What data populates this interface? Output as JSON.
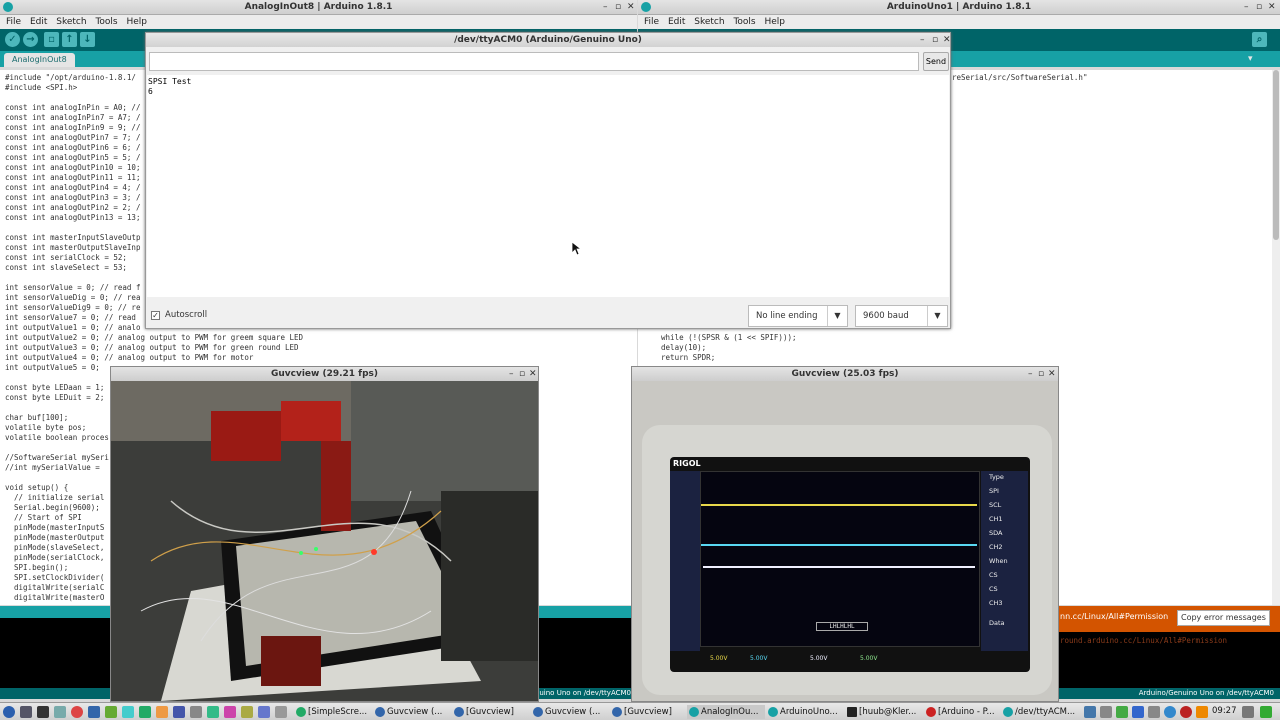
{
  "left_window": {
    "title": "AnalogInOut8 | Arduino 1.8.1",
    "menu": [
      "File",
      "Edit",
      "Sketch",
      "Tools",
      "Help"
    ],
    "tab": "AnalogInOut8",
    "code_lines": [
      "#include \"/opt/arduino-1.8.1/",
      "#include <SPI.h>",
      "",
      "const int analogInPin = A0; //",
      "const int analogInPin7 = A7; /",
      "const int analogInPin9 = 9; //",
      "const int analogOutPin7 = 7; /",
      "const int analogOutPin6 = 6; /",
      "const int analogOutPin5 = 5; /",
      "const int analogOutPin10 = 10;",
      "const int analogOutPin11 = 11;",
      "const int analogOutPin4 = 4; /",
      "const int analogOutPin3 = 3; /",
      "const int analogOutPin2 = 2; /",
      "const int analogOutPin13 = 13;",
      "",
      "const int masterInputSlaveOutp",
      "const int masterOutputSlaveInp",
      "const int serialClock = 52;",
      "const int slaveSelect = 53;",
      "",
      "int sensorValue = 0; // read f",
      "int sensorValueDig = 0; // rea",
      "int sensorValueDig9 = 0; // re",
      "int sensorValue7 = 0; // read",
      "int outputValue1 = 0; // analo",
      "int outputValue2 = 0; // analog output to PWM for greem square LED",
      "int outputValue3 = 0; // analog output to PWM for green round LED",
      "int outputValue4 = 0; // analog output to PWM for motor",
      "int outputValue5 = 0;",
      "",
      "const byte LEDaan = 1;",
      "const byte LEDuit = 2;",
      "",
      "char buf[100];",
      "volatile byte pos;",
      "volatile boolean proces",
      "",
      "//SoftwareSerial mySeri",
      "//int mySerialValue =",
      "",
      "void setup() {",
      "  // initialize serial",
      "  Serial.begin(9600);",
      "  // Start of SPI",
      "  pinMode(masterInputS",
      "  pinMode(masterOutput",
      "  pinMode(slaveSelect,",
      "  pinMode(serialClock,",
      "  SPI.begin();",
      "  SPI.setClockDivider(",
      "  digitalWrite(serialC",
      "  digitalWrite(masterO"
    ],
    "footer": "Arduino/Genuino Uno on /dev/ttyACM0"
  },
  "right_window": {
    "title": "ArduinoUno1 | Arduino 1.8.1",
    "menu": [
      "File",
      "Edit",
      "Sketch",
      "Tools",
      "Help"
    ],
    "code_top": "reSerial/src/SoftwareSerial.h\"",
    "code_lines": [
      "  while (!(SPSR & (1 << SPIF)));",
      "  delay(10);",
      "  return SPDR;"
    ],
    "error_text": "nn.cc/Linux/All#Permission",
    "error_button": "Copy error messages",
    "console_link": "round.arduino.cc/Linux/All#Permission",
    "footer": "Arduino/Genuino Uno on /dev/ttyACM0"
  },
  "serial_monitor": {
    "title": "/dev/ttyACM0 (Arduino/Genuino Uno)",
    "input_value": "",
    "send_label": "Send",
    "output_lines": [
      "SPSI Test",
      "6"
    ],
    "autoscroll_label": "Autoscroll",
    "line_ending": "No line ending",
    "baud": "9600 baud"
  },
  "guvc_left": {
    "title": "Guvcview  (29.21 fps)"
  },
  "guvc_right": {
    "title": "Guvcview  (25.03 fps)"
  },
  "scope": {
    "brand": "RIGOL",
    "ch1": "5.00V",
    "ch2": "5.00V",
    "ch3": "5.00V",
    "ch4": "5.00V",
    "menu": [
      "Type",
      "SPI",
      "SCL",
      "CH1",
      "SDA",
      "CH2",
      "When",
      "CS",
      "CS",
      "CH3",
      "Data"
    ],
    "decode": "LHLHLHL"
  },
  "taskbar": {
    "tasks": [
      "[SimpleScre...",
      "Guvcview (...",
      "[Guvcview]",
      "Guvcview (...",
      "[Guvcview]",
      "AnalogInOu...",
      "ArduinoUno...",
      "[huub@Kler...",
      "[Arduino - P...",
      "/dev/ttyACM..."
    ],
    "clock": "09:27"
  },
  "colors": {
    "arduino_teal": "#006468",
    "arduino_light": "#17a1a5"
  }
}
